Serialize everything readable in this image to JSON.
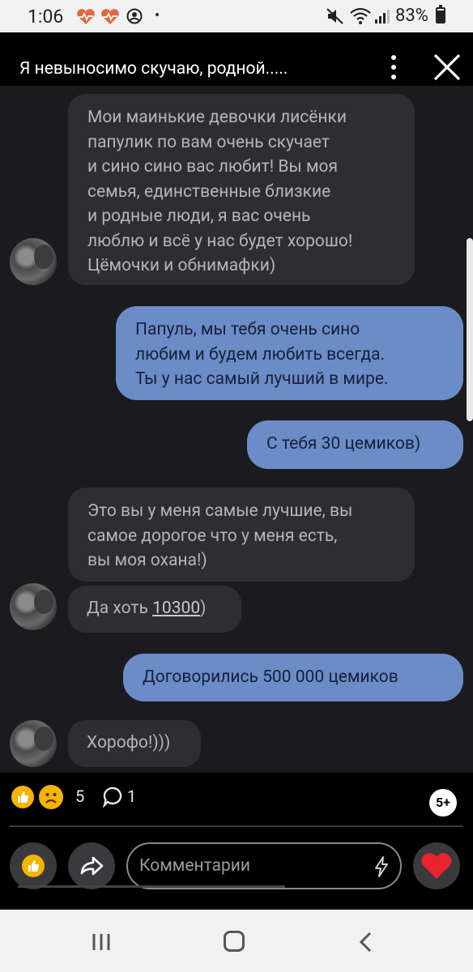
{
  "status_bar": {
    "time": "1:06",
    "battery": "83%"
  },
  "header": {
    "title": "Я невыносимо скучаю, родной....."
  },
  "messages": [
    {
      "side": "in",
      "lines": [
        "Мои маинькие девочки лисёнки",
        "папулик по вам очень скучает",
        "и сино сино вас любит! Вы моя",
        "семья, единственные близкие",
        "и родные люди, я вас очень",
        "люблю и всё у нас будет хорошо!",
        "Цёмочки и обнимафки)"
      ]
    },
    {
      "side": "out",
      "lines": [
        "Папуль, мы тебя очень сино",
        "любим и будем любить всегда.",
        "Ты у нас самый лучший в мире."
      ]
    },
    {
      "side": "out",
      "lines": [
        "С тебя 30 цемиков)"
      ]
    },
    {
      "side": "in",
      "lines": [
        "Это вы у меня самые лучшие, вы",
        "самое дорогое что у меня есть,",
        "вы моя охана!)"
      ]
    },
    {
      "side": "in",
      "prefix": "Да хоть ",
      "link": "10300",
      "suffix": ")"
    },
    {
      "side": "out",
      "lines": [
        "Договорились 500 000 цемиков"
      ]
    },
    {
      "side": "in",
      "lines": [
        "Хорофо!)))"
      ]
    }
  ],
  "reactions": {
    "count": "5",
    "comments_count": "1",
    "viewers_badge": "5+"
  },
  "composer": {
    "placeholder": "Комментарии"
  },
  "colors": {
    "chat_bg": "#1b1b1f",
    "incoming_bubble": "#2d2d32",
    "outgoing_bubble": "#6b8cc7",
    "reaction_yellow": "#f5b400",
    "heart_red": "#e8232c"
  },
  "icons": {
    "status": [
      "heart-pulse-icon",
      "heart-pulse-icon",
      "account-circle-icon",
      "mute-icon",
      "wifi-icon",
      "signal-icon",
      "battery-icon"
    ],
    "header": [
      "more-vertical-icon",
      "close-icon"
    ],
    "actions": [
      "like-icon",
      "sad-face-icon",
      "comment-icon",
      "share-icon",
      "bolt-icon",
      "heart-icon"
    ],
    "nav": [
      "recents-icon",
      "home-icon",
      "back-icon"
    ]
  }
}
